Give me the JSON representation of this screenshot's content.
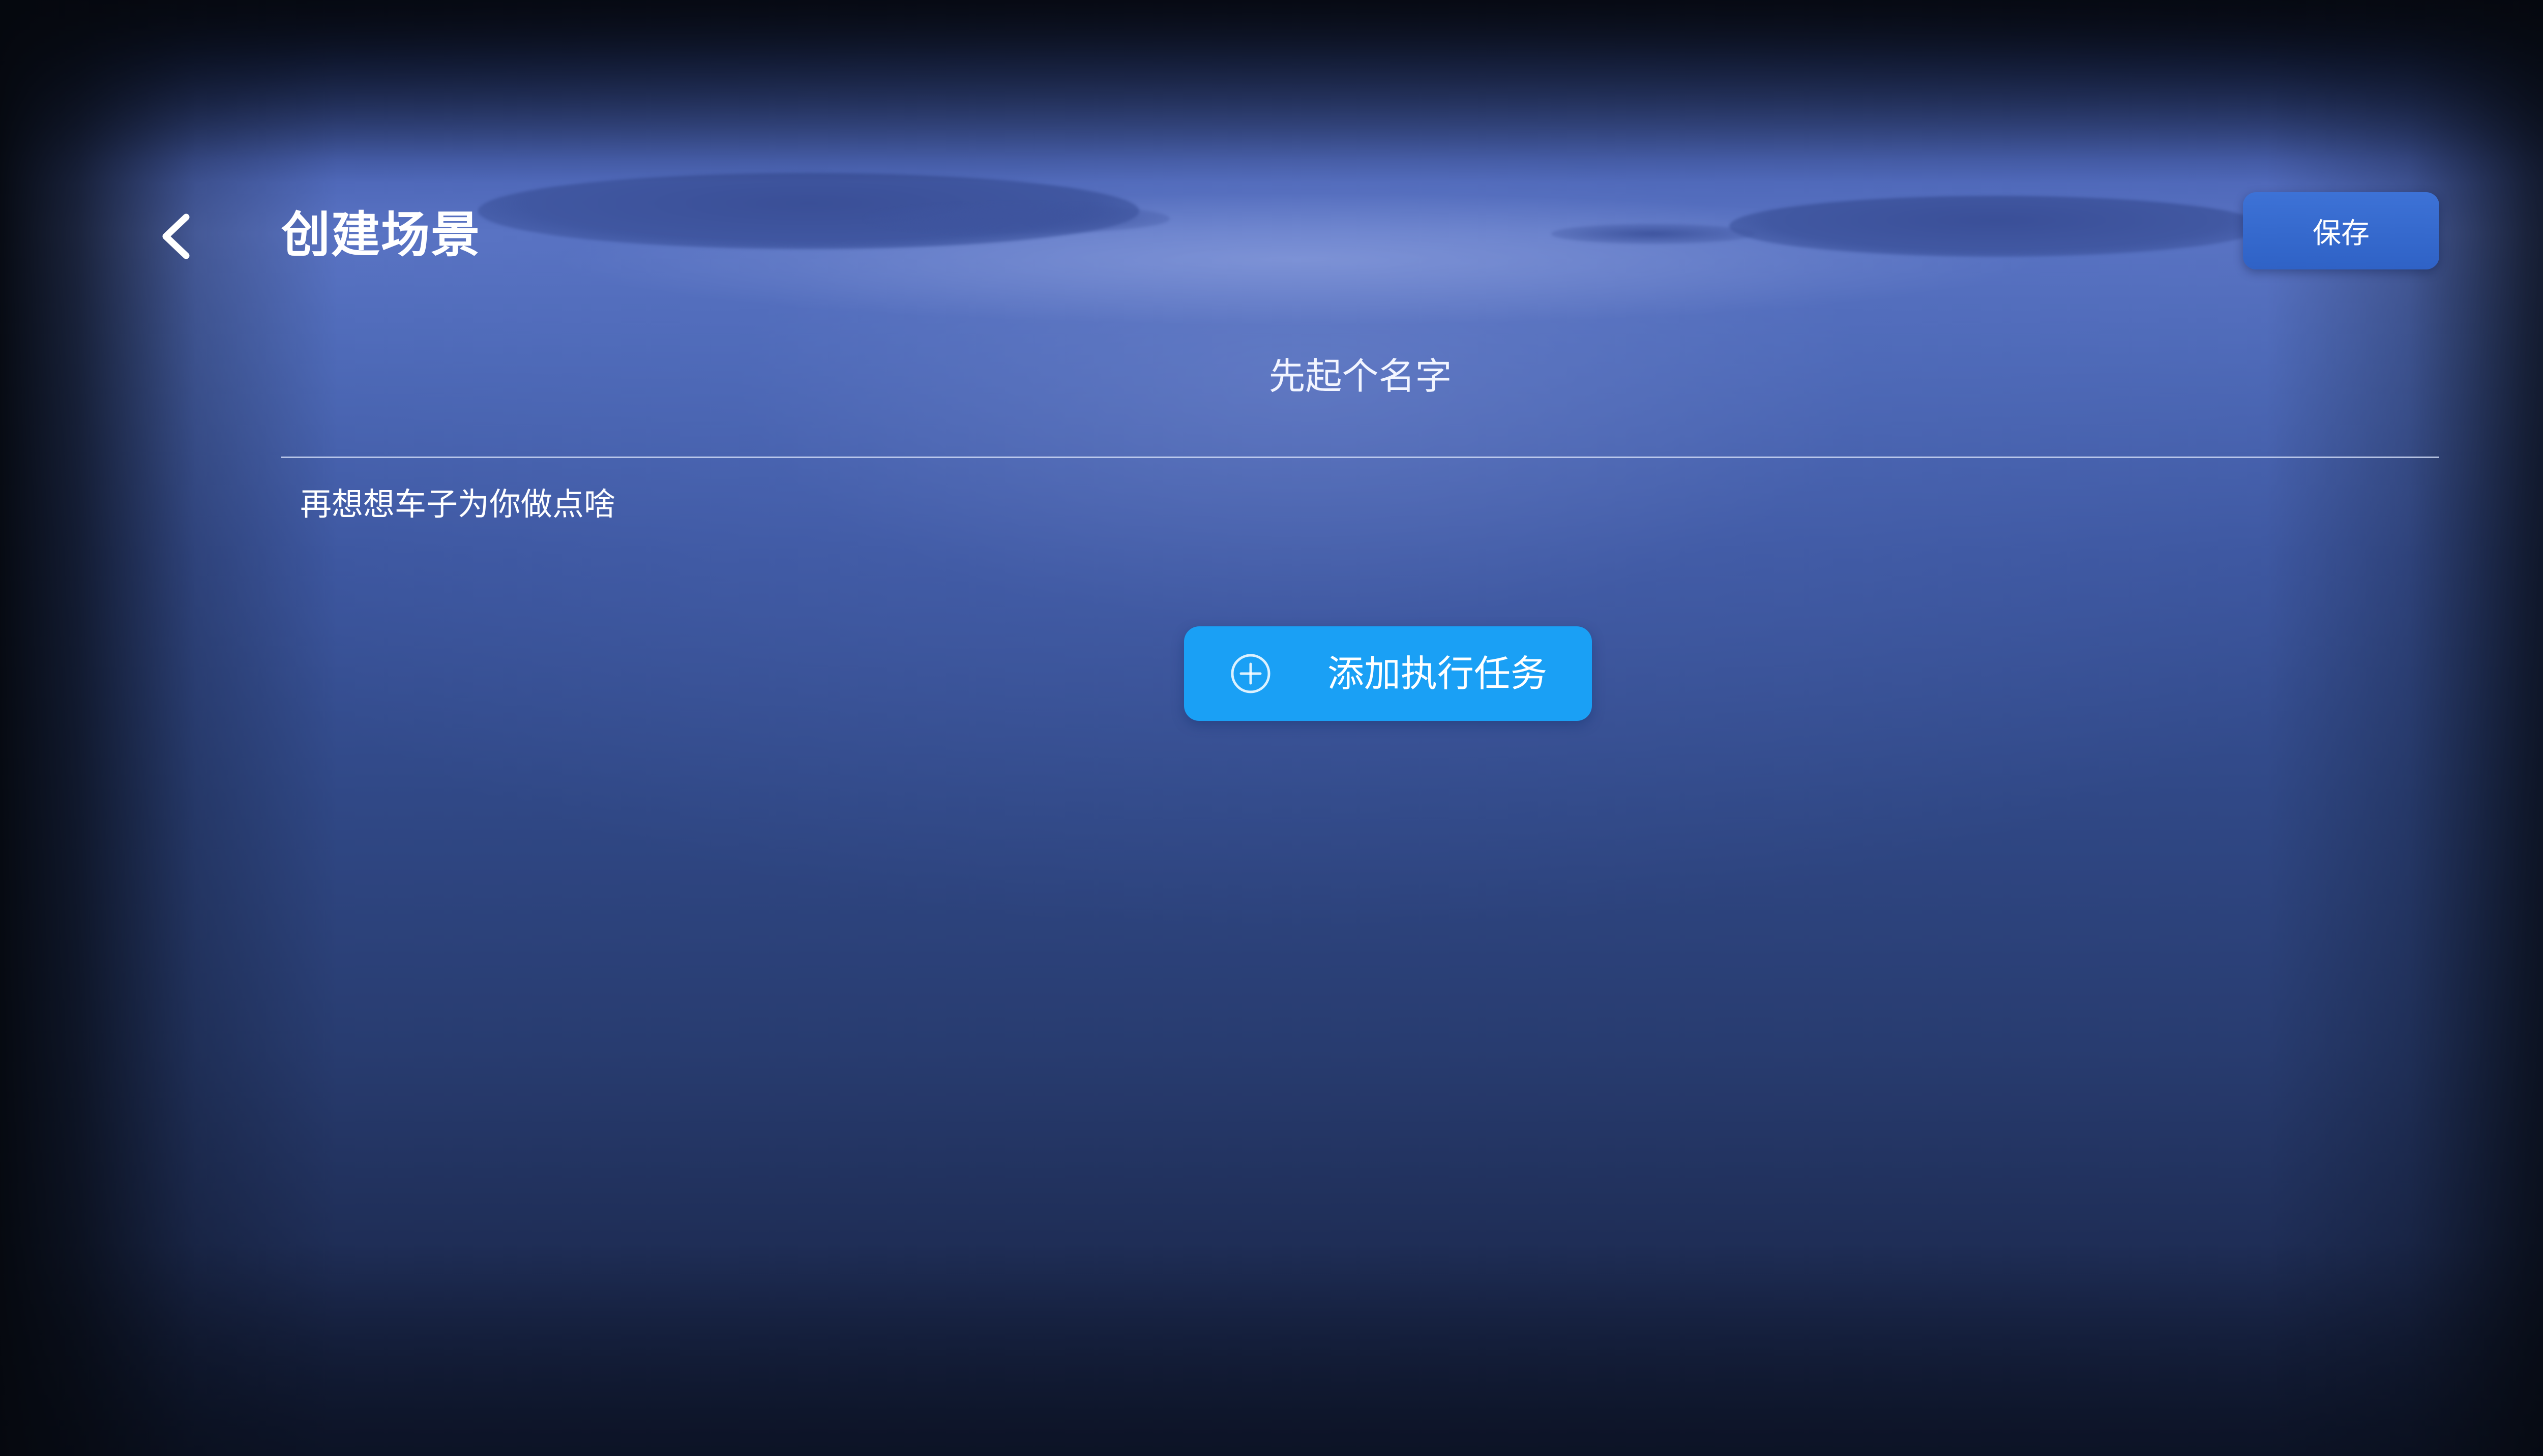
{
  "header": {
    "back_icon": "chevron-left-icon",
    "title": "创建场景",
    "save_label": "保存"
  },
  "scene_name": {
    "placeholder": "先起个名字",
    "value": ""
  },
  "tasks_section": {
    "label": "再想想车子为你做点啥",
    "add_button_label": "添加执行任务",
    "add_button_icon": "plus-circle-icon"
  },
  "colors": {
    "accent": "#1aa0f5",
    "save_button": "#3468cc",
    "background_top": "#5a74c4",
    "background_bottom": "#1d2b52"
  }
}
